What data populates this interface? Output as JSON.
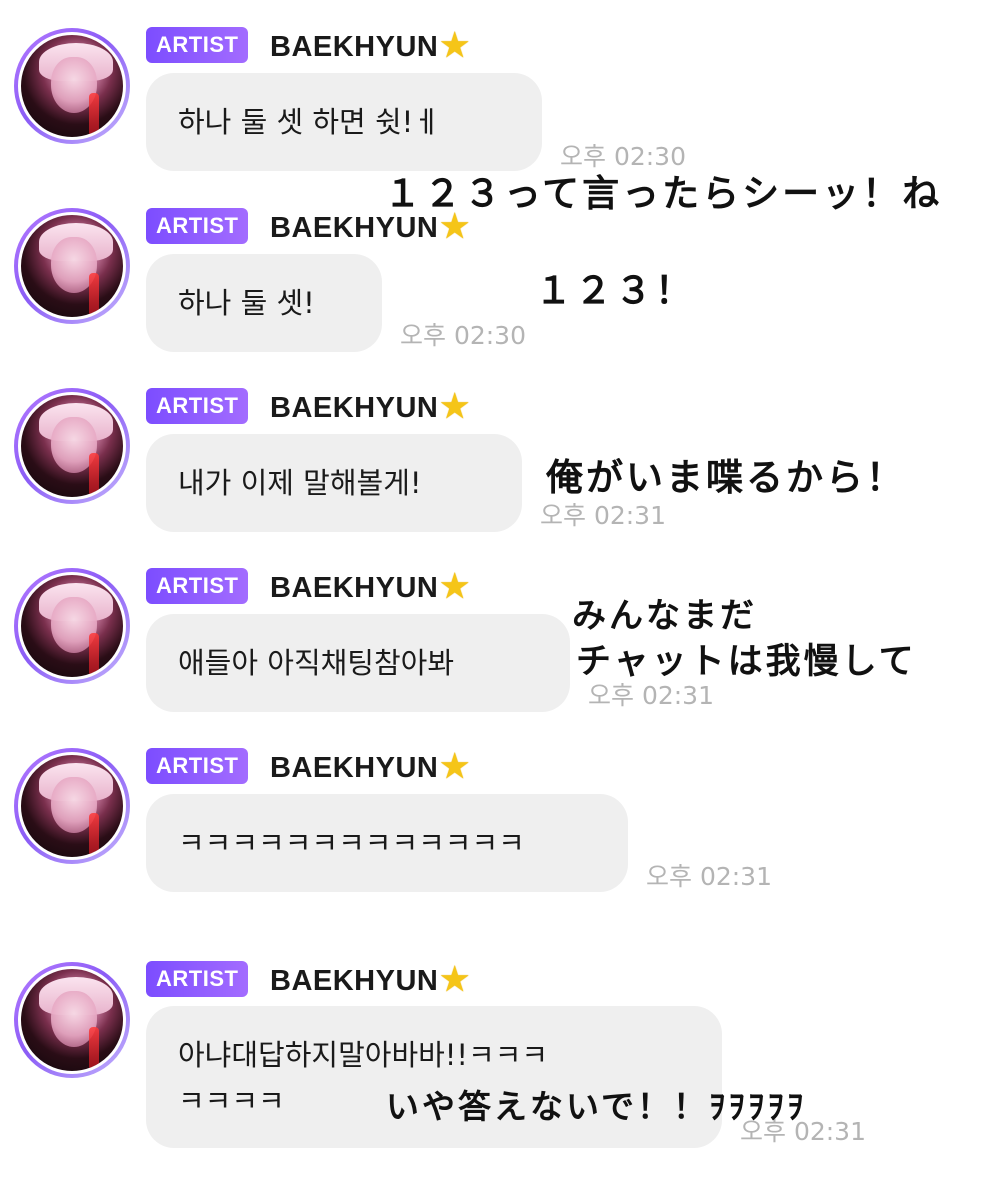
{
  "messages": [
    {
      "badge": "ARTIST",
      "name": "BAEKHYUN",
      "lines": [
        "하나 둘 셋 하면 쉿!ㅔ"
      ],
      "time": "오후 02:30",
      "note": [
        "１２３って言ったらシーッ！ね"
      ]
    },
    {
      "badge": "ARTIST",
      "name": "BAEKHYUN",
      "lines": [
        "하나 둘 셋!"
      ],
      "time": "오후 02:30",
      "note": [
        "１２３！"
      ]
    },
    {
      "badge": "ARTIST",
      "name": "BAEKHYUN",
      "lines": [
        "내가 이제 말해볼게!"
      ],
      "time": "오후 02:31",
      "note": [
        "俺がいま喋るから！"
      ]
    },
    {
      "badge": "ARTIST",
      "name": "BAEKHYUN",
      "lines": [
        "애들아 아직채팅참아봐"
      ],
      "time": "오후 02:31",
      "note": [
        "みんなまだ",
        "チャットは我慢して"
      ]
    },
    {
      "badge": "ARTIST",
      "name": "BAEKHYUN",
      "lines": [
        "ㅋㅋㅋㅋㅋㅋㅋㅋㅋㅋㅋㅋㅋ"
      ],
      "time": "오후 02:31",
      "note": []
    },
    {
      "badge": "ARTIST",
      "name": "BAEKHYUN",
      "lines": [
        "아냐대답하지말아바바!!ㅋㅋㅋ",
        "ㅋㅋㅋㅋ"
      ],
      "time": "오후 02:31",
      "note": [
        "いや答えないで！！ｦｦｦｦｦ"
      ]
    }
  ],
  "icons": {
    "star": "star-icon",
    "avatar": "profile-avatar"
  },
  "colors": {
    "badge": "#8b5cf6",
    "bubble": "#efefef",
    "time": "#b4b4b4",
    "star": "#f5c518"
  }
}
